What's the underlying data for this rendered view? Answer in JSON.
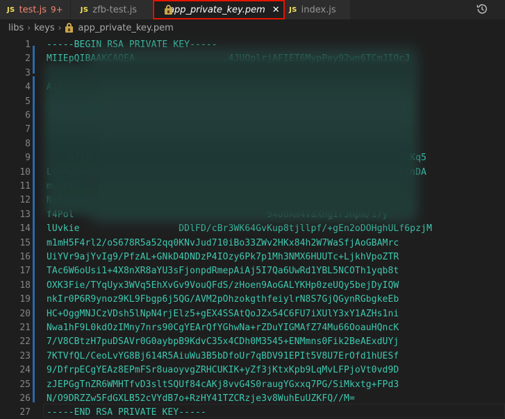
{
  "tabs": [
    {
      "label": "test.js",
      "type": "js",
      "badge": "9+",
      "error": true
    },
    {
      "label": "zfb-test.js",
      "type": "js",
      "badge": "",
      "error": false
    },
    {
      "label": "app_private_key.pem",
      "type": "pem",
      "active": true,
      "close": "✕"
    },
    {
      "label": "index.js",
      "type": "js",
      "badge": "",
      "error": false
    }
  ],
  "js_icon_text": "JS",
  "breadcrumb": [
    "libs",
    "keys",
    "app_private_key.pem"
  ],
  "breadcrumb_sep": "›",
  "lines": [
    {
      "n": "1",
      "text": "-----BEGIN RSA PRIVATE KEY-----"
    },
    {
      "n": "2",
      "text": "MIIEpQIBAAKCAQEA                .4JUQplrjAFIET6MypPey92wn6TCmJIOcJ"
    },
    {
      "n": "3",
      "text": ""
    },
    {
      "n": "4",
      "text": "Afl"
    },
    {
      "n": "5",
      "text": ""
    },
    {
      "n": "6",
      "text": ""
    },
    {
      "n": "7",
      "text": ""
    },
    {
      "n": "8",
      "text": ""
    },
    {
      "n": "9",
      "text": "    6/iJCwsSBKhKUD7MU8Z2IQdeswW+9s                             FixKq5"
    },
    {
      "n": "10",
      "text": "Lvn6w8anmDl+ddDEEI                                +JZs70KCfIgRCmqInDA"
    },
    {
      "n": "11",
      "text": "mw/8th                                                          "
    },
    {
      "n": "12",
      "text": "Nk9p9qQ/A0"
    },
    {
      "n": "13",
      "text": "f4Pol                                   94oOAm4VaXHgIr3Hpm/17y"
    },
    {
      "n": "14",
      "text": "lUvkie                  DDlFD/cBr3WK64GvKup8tjllpf/+gEn2oDOHghULf6pzjM"
    },
    {
      "n": "15",
      "text": "m1mH5F4rl2/oS678R5a52qq0KNvJud710iBo33ZWv2HKx84h2W7WaSfjAoGBAMrc"
    },
    {
      "n": "16",
      "text": "UiYVr9ajYvIg9/PfzAL+GNkD4DNDzP4IOzy6Pk7p1Mh3NMX6HUUTc+LjkhVpoZTR"
    },
    {
      "n": "17",
      "text": "TAc6W6oUsi1+4X8nXR8aYU3sFjonpdRmepAiAj5I7Qa6UwRd1YBL5NCOTh1yqb8t"
    },
    {
      "n": "18",
      "text": "OXK3Fie/TYqUyx3WVq5EhXvGv9VouQFdS/zHoen9AoGALYKHp0zeUQy5bejDyIQW"
    },
    {
      "n": "19",
      "text": "nkIr0P6R9ynoz9KL9Fbgp6j5QG/AVM2pOhzokgthfeiylrN8S7GjQGynRGbgkeEb"
    },
    {
      "n": "20",
      "text": "HC+OggMNJCzVDsh5lNpN4rjElz5+gEX4SSAtQoJZx54C6FU7iXUlY3xY1AZHs1ni"
    },
    {
      "n": "21",
      "text": "Nwa1hF9L0kdOzIMny7nrs90CgYEArQfYGhwNa+rZDuYIGMAfZ74Mu66OoauHQncK"
    },
    {
      "n": "22",
      "text": "7/V8CBtzH7puDSAVr0G0aybpB9KdvC35x4CDh0M3545+ENMmns0Fik2BeAExdUYj"
    },
    {
      "n": "23",
      "text": "7KTVfQL/CeoLvYG8Bj614R5AiuWu3B5bDfoUr7qBDV91EPIt5V8U7ErOfd1hUESf"
    },
    {
      "n": "24",
      "text": "9/DfrpECgYEAz8EPmFSr8uaoyvgZRHCUKIK+yZf3jKtxKpb9LqMvLFPjoVt0vd9D"
    },
    {
      "n": "25",
      "text": "zJEPGgTnZR6WMHTfvD3sltSQUf84cAKj8vvG4S0raugYGxxq7PG/SiMkxtg+FPd3"
    },
    {
      "n": "26",
      "text": "N/O9DRZZw5FdGXLB52cVYdB7o+RzHY41TZCRzje3v8WuhEuUZKFQ//M="
    },
    {
      "n": "27",
      "text": "-----END RSA PRIVATE KEY-----"
    },
    {
      "n": "28",
      "text": ""
    }
  ]
}
